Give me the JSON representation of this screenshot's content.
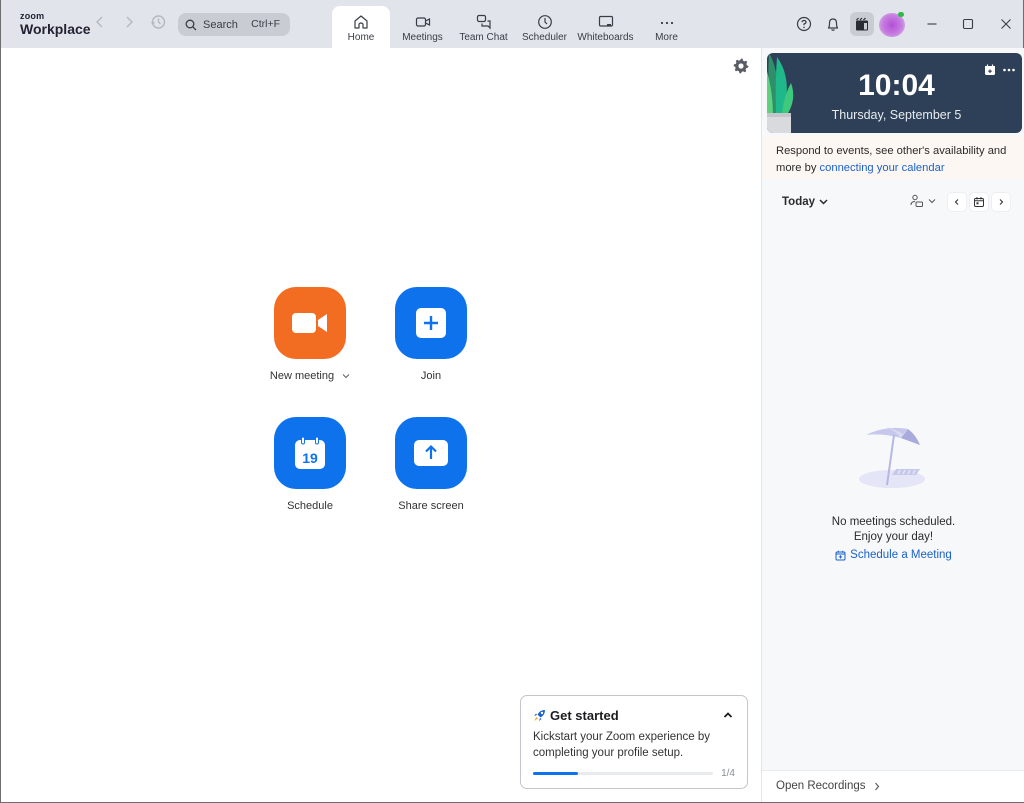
{
  "app": {
    "logo_small": "zoom",
    "logo_big": "Workplace"
  },
  "search": {
    "placeholder": "Search",
    "shortcut": "Ctrl+F"
  },
  "tabs": [
    {
      "label": "Home",
      "icon": "home-icon",
      "active": true
    },
    {
      "label": "Meetings",
      "icon": "video-camera-icon",
      "active": false
    },
    {
      "label": "Team Chat",
      "icon": "chat-bubbles-icon",
      "active": false
    },
    {
      "label": "Scheduler",
      "icon": "clock-icon",
      "active": false
    },
    {
      "label": "Whiteboards",
      "icon": "whiteboard-icon",
      "active": false
    },
    {
      "label": "More",
      "icon": "more-dots-icon",
      "active": false
    }
  ],
  "actions": {
    "new_meeting": "New meeting",
    "join": "Join",
    "schedule": "Schedule",
    "schedule_day": "19",
    "share_screen": "Share screen"
  },
  "get_started": {
    "title": "Get started",
    "description": "Kickstart your Zoom experience by completing your profile setup.",
    "progress_current": 1,
    "progress_total": 4,
    "progress_label": "1/4"
  },
  "clock": {
    "time": "10:04",
    "date": "Thursday, September 5"
  },
  "calendar_banner": {
    "text": "Respond to events, see other's availability and more by ",
    "link": "connecting your calendar"
  },
  "calendar": {
    "range_label": "Today",
    "empty_line1": "No meetings scheduled.",
    "empty_line2": "Enjoy your day!",
    "schedule_link": "Schedule a Meeting"
  },
  "footer": {
    "open_recordings": "Open Recordings"
  },
  "colors": {
    "accent_blue": "#0e72ed",
    "new_meeting_orange": "#f26d21",
    "clock_card_bg": "#2e4057",
    "presence_green": "#2db84d"
  }
}
